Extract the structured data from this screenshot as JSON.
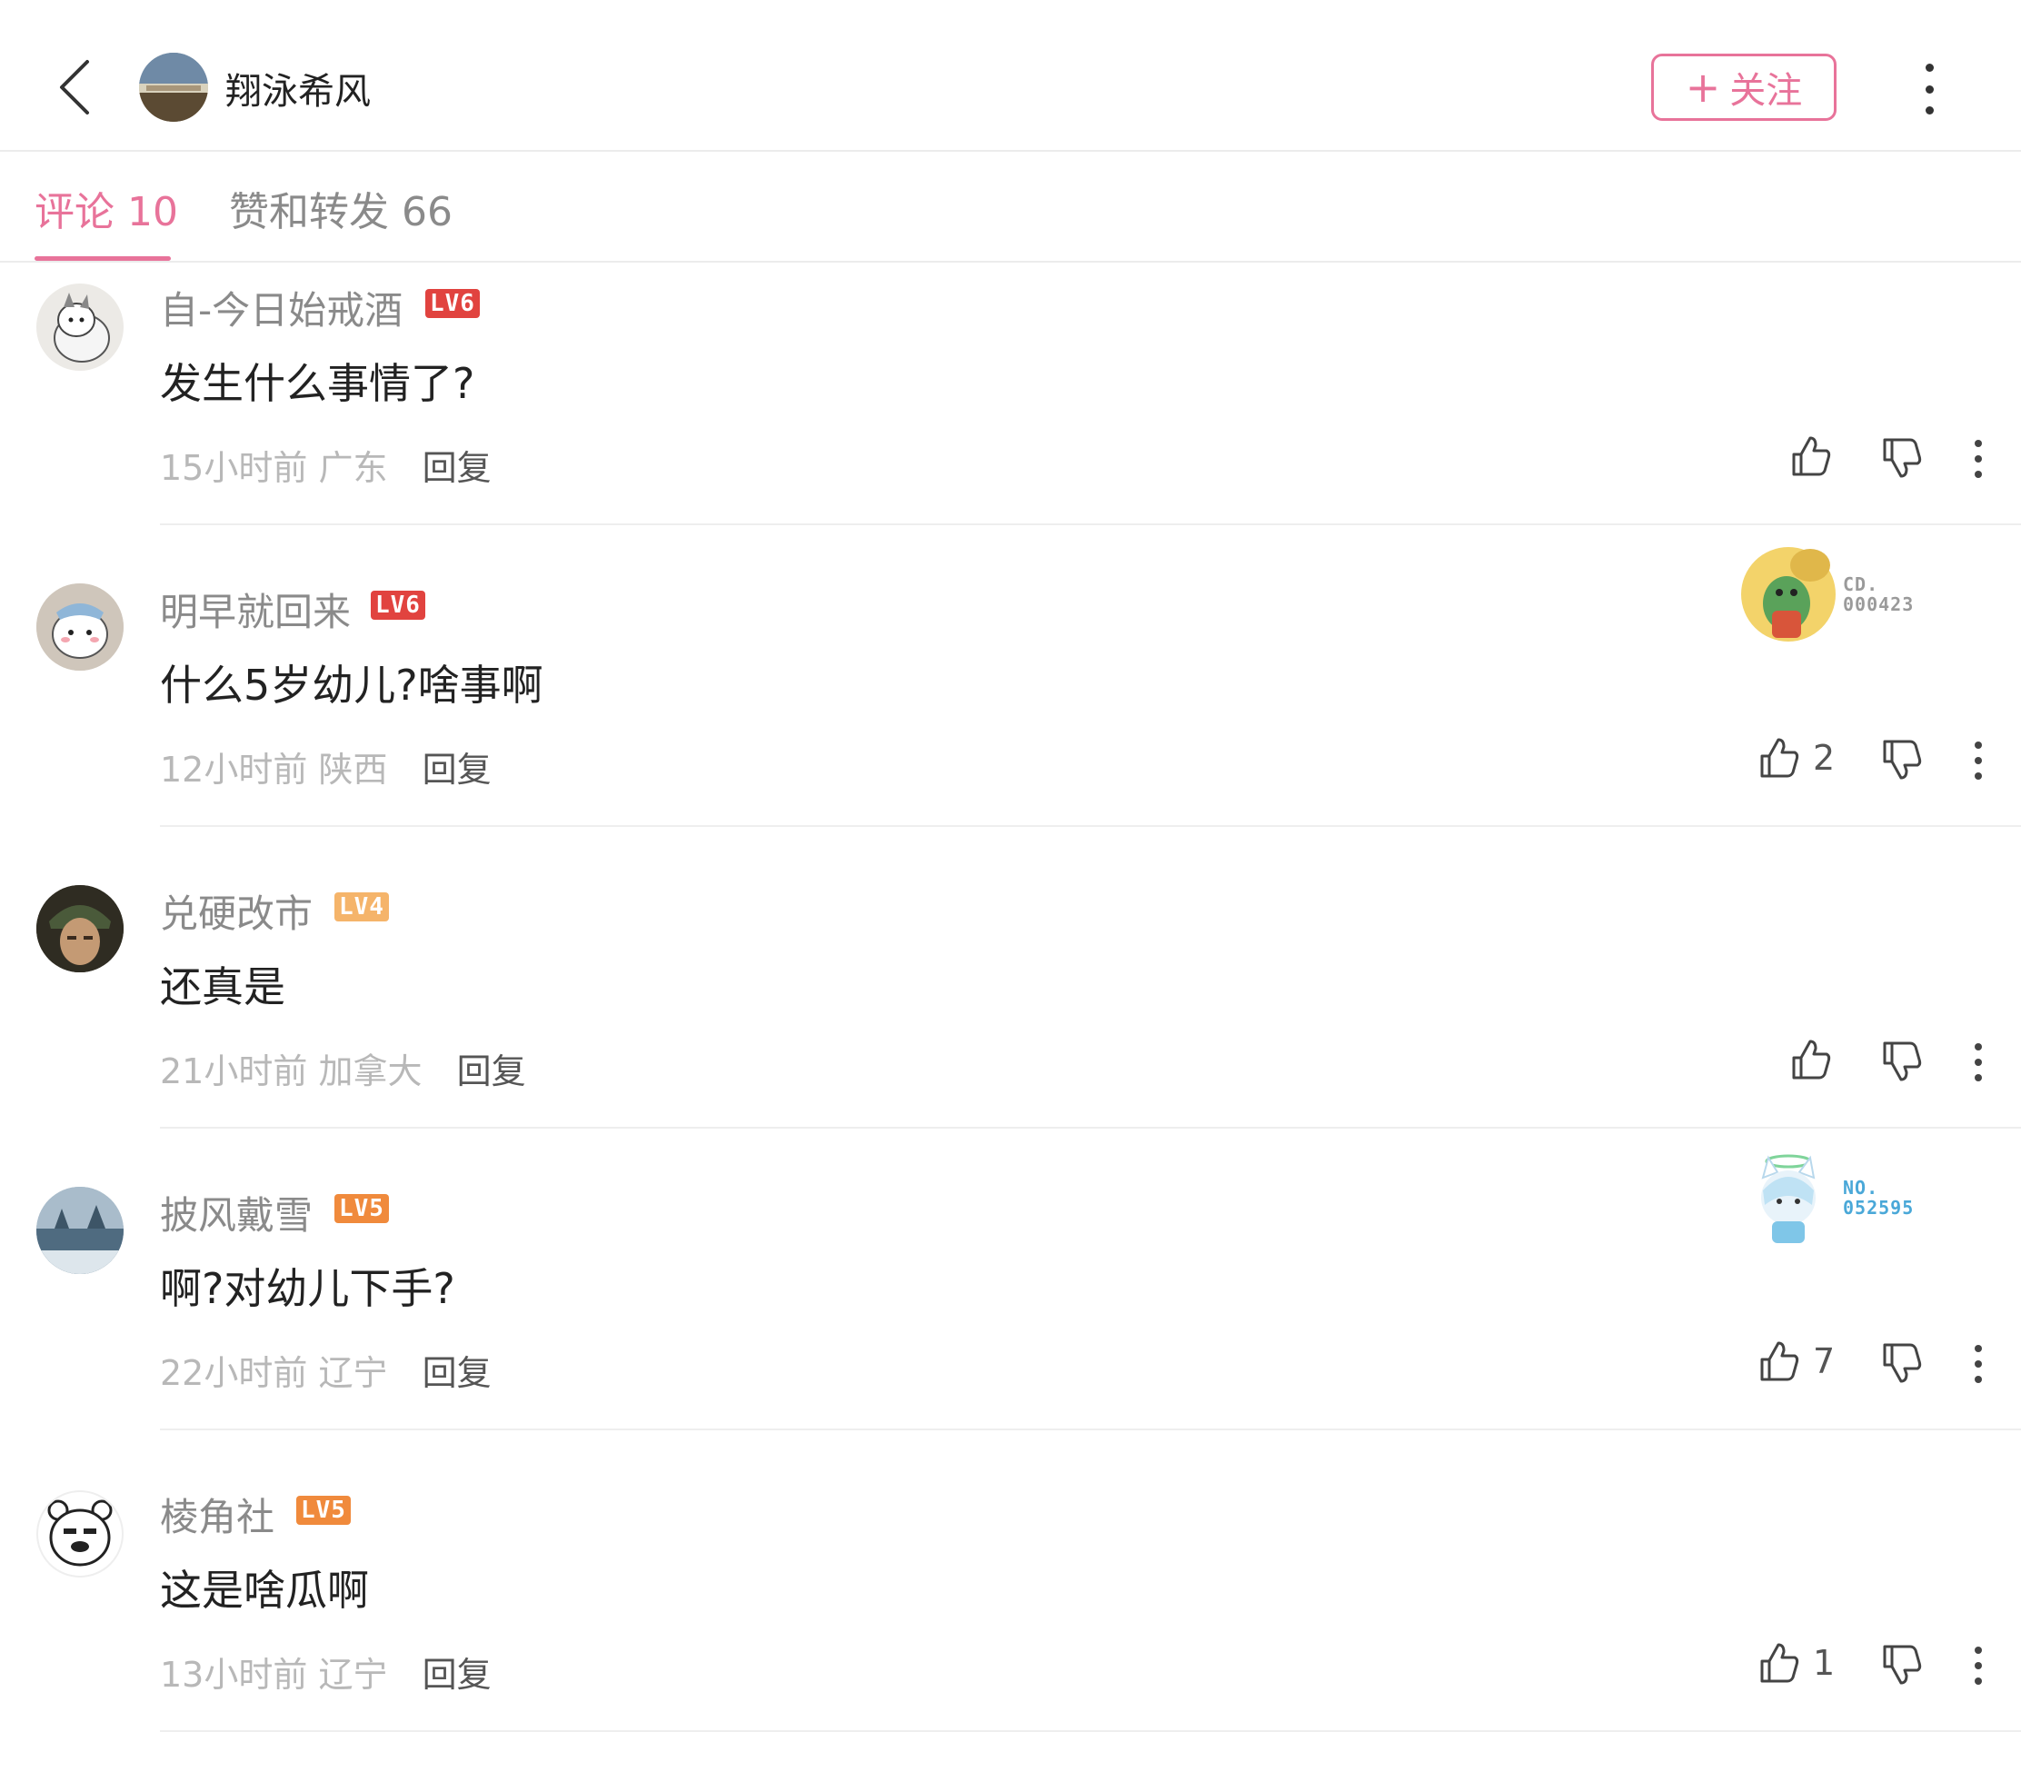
{
  "header": {
    "author_name": "翔泳希风",
    "follow_label": "关注",
    "follow_plus": "+"
  },
  "tabs": [
    {
      "label": "评论 10",
      "active": true
    },
    {
      "label": "赞和转发 66",
      "active": false
    }
  ],
  "colors": {
    "accent": "#e8739a",
    "lv6": "#e1433f",
    "lv5": "#f08a3c",
    "lv4": "#f5b46a"
  },
  "comments": [
    {
      "user": "自-今日始戒酒",
      "level": "LV6",
      "text": "发生什么事情了?",
      "time": "15小时前",
      "location": "广东",
      "reply": "回复",
      "likes": ""
    },
    {
      "user": "明早就回来",
      "level": "LV6",
      "text": "什么5岁幼儿?啥事啊",
      "time": "12小时前",
      "location": "陕西",
      "reply": "回复",
      "likes": "2",
      "badge": {
        "line1": "CD.",
        "line2": "000423"
      }
    },
    {
      "user": "兑硬改市",
      "level": "LV4",
      "text": "还真是",
      "time": "21小时前",
      "location": "加拿大",
      "reply": "回复",
      "likes": ""
    },
    {
      "user": "披风戴雪",
      "level": "LV5",
      "text": "啊?对幼儿下手?",
      "time": "22小时前",
      "location": "辽宁",
      "reply": "回复",
      "likes": "7",
      "badge": {
        "line1": "NO.",
        "line2": "052595"
      }
    },
    {
      "user": "棱角社",
      "level": "LV5",
      "text": "这是啥瓜啊",
      "time": "13小时前",
      "location": "辽宁",
      "reply": "回复",
      "likes": "1"
    }
  ]
}
